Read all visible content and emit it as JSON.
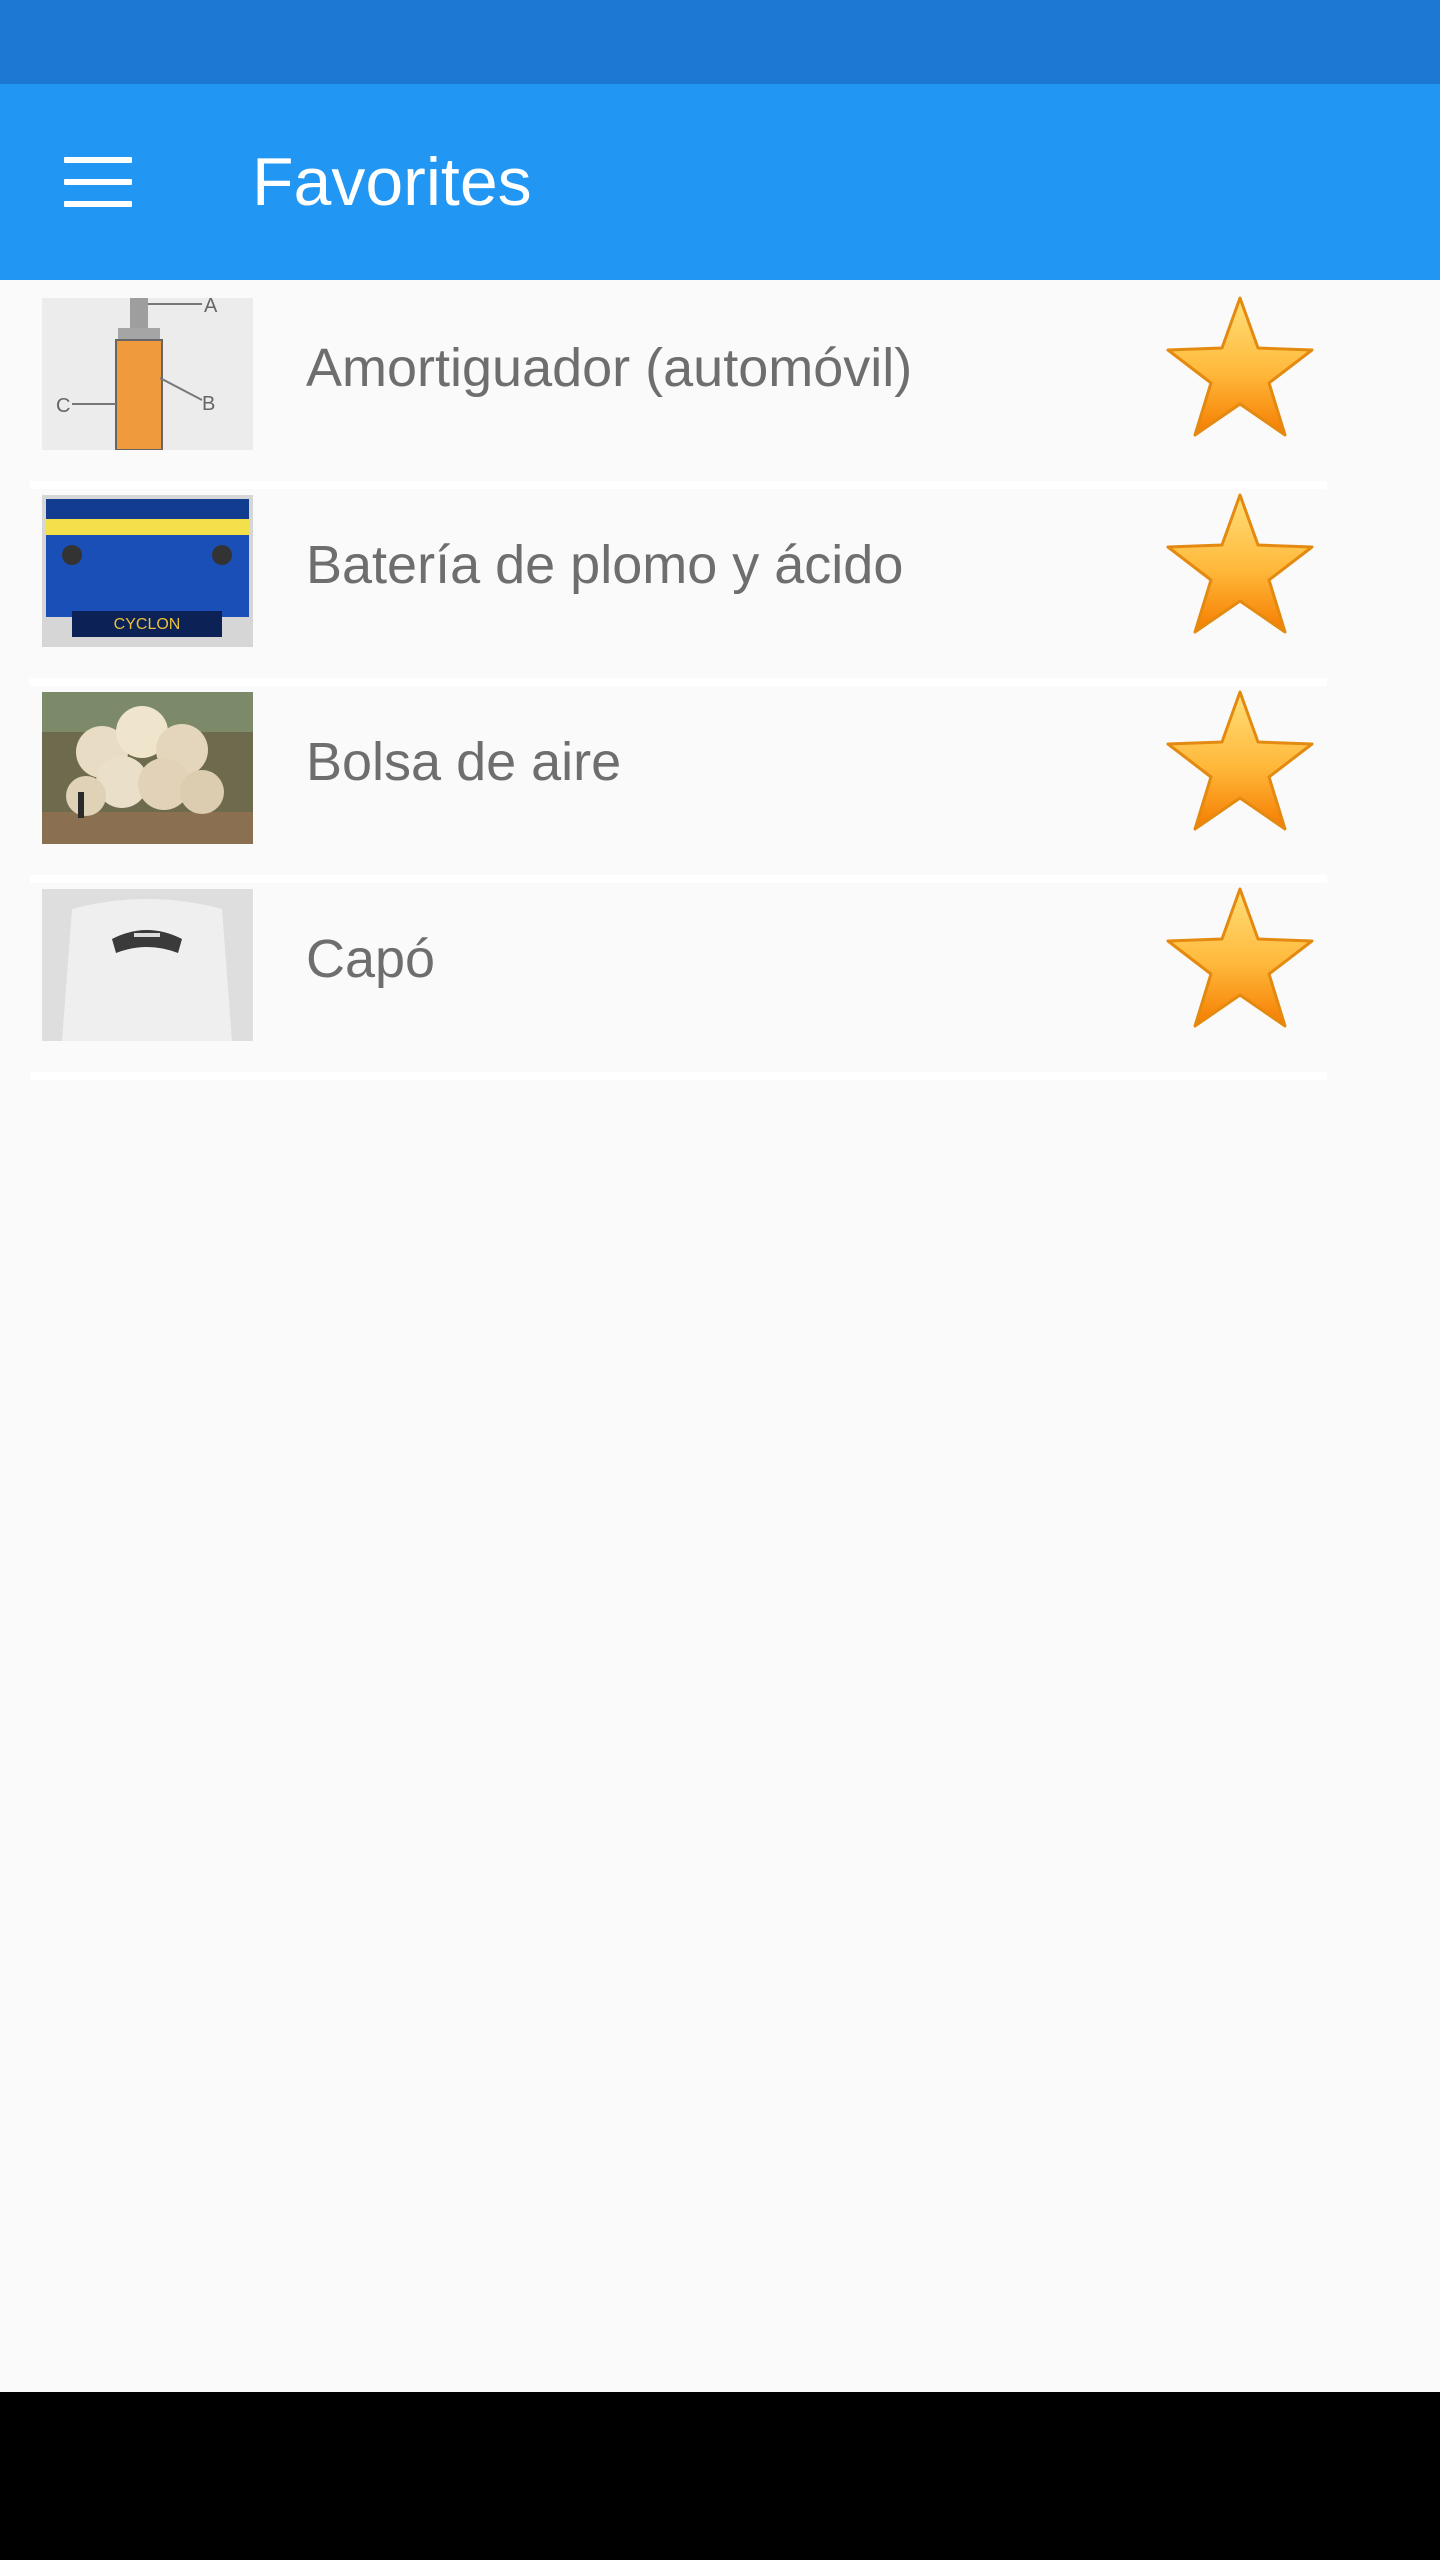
{
  "app_bar": {
    "title": "Favorites",
    "menu_icon": "hamburger-menu-icon",
    "color": "#2196f3",
    "status_bar_color": "#1c78d2"
  },
  "favorites": [
    {
      "label": "Amortiguador (automóvil)",
      "thumbnail": "shock-absorber-diagram",
      "diagram_labels": [
        "A",
        "B",
        "C"
      ],
      "starred": true
    },
    {
      "label": "Batería de plomo y ácido",
      "thumbnail": "car-battery-photo",
      "battery_brand": "CYCLON",
      "starred": true
    },
    {
      "label": "Bolsa de aire",
      "thumbnail": "airbag-photo",
      "starred": true
    },
    {
      "label": "Capó",
      "thumbnail": "car-hood-photo",
      "starred": true
    }
  ],
  "star_icon": "star-icon",
  "star_color": "#ffa726"
}
